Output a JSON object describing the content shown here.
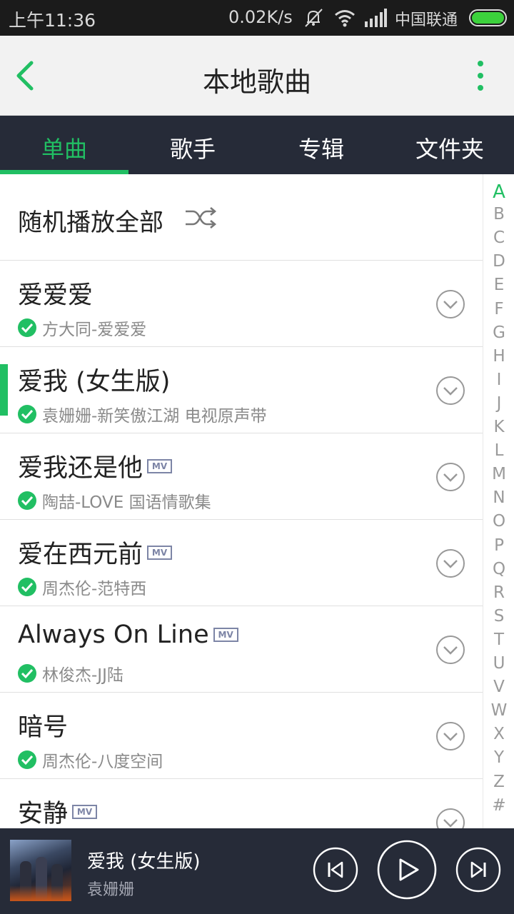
{
  "status_bar": {
    "time": "上午11:36",
    "speed": "0.02K/s",
    "carrier": "中国联通",
    "icons": [
      "mute-icon",
      "wifi-icon",
      "signal-icon",
      "battery-icon"
    ],
    "battery_color": "#3cd13c"
  },
  "header": {
    "title": "本地歌曲",
    "back_icon": "chevron-left-icon",
    "more_icon": "more-vertical-icon",
    "accent": "#21bf63"
  },
  "tabs": [
    {
      "label": "单曲",
      "active": true
    },
    {
      "label": "歌手",
      "active": false
    },
    {
      "label": "专辑",
      "active": false
    },
    {
      "label": "文件夹",
      "active": false
    }
  ],
  "shuffle": {
    "label": "随机播放全部",
    "icon": "shuffle-icon"
  },
  "songs": [
    {
      "title": "爱爱爱",
      "subtitle": "方大同-爱爱爱",
      "mv": false,
      "playing": false
    },
    {
      "title": "爱我 (女生版)",
      "subtitle": "袁姗姗-新笑傲江湖 电视原声带",
      "mv": false,
      "playing": true
    },
    {
      "title": "爱我还是他",
      "subtitle": "陶喆-LOVE 国语情歌集",
      "mv": true,
      "playing": false
    },
    {
      "title": "爱在西元前",
      "subtitle": "周杰伦-范特西",
      "mv": true,
      "playing": false
    },
    {
      "title": "Always On Line",
      "subtitle": "林俊杰-JJ陆",
      "mv": true,
      "playing": false
    },
    {
      "title": "暗号",
      "subtitle": "周杰伦-八度空间",
      "mv": false,
      "playing": false
    },
    {
      "title": "安静",
      "subtitle": "",
      "mv": true,
      "playing": false
    }
  ],
  "mv_label": "MV",
  "alphabet": [
    "A",
    "B",
    "C",
    "D",
    "E",
    "F",
    "G",
    "H",
    "I",
    "J",
    "K",
    "L",
    "M",
    "N",
    "O",
    "P",
    "Q",
    "R",
    "S",
    "T",
    "U",
    "V",
    "W",
    "X",
    "Y",
    "Z",
    "#"
  ],
  "alphabet_active": "A",
  "player": {
    "title": "爱我 (女生版)",
    "artist": "袁姗姗",
    "cover_art": "album-cover-image",
    "controls": [
      "previous-icon",
      "play-icon",
      "next-icon"
    ]
  }
}
